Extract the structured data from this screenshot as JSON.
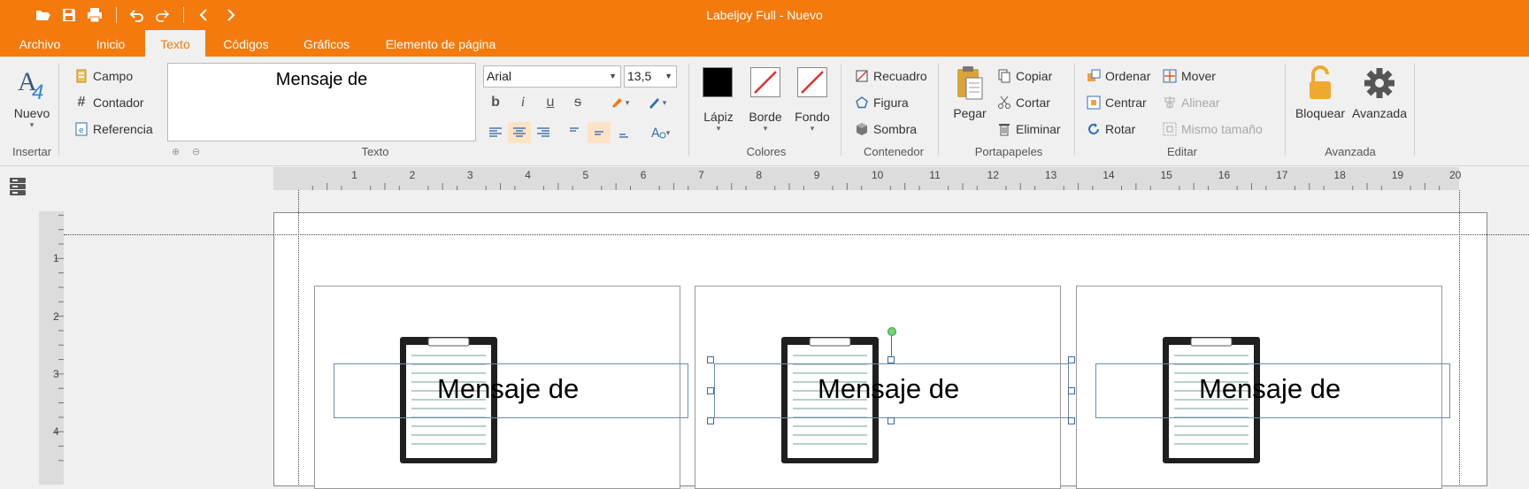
{
  "window": {
    "title": "Labeljoy Full - Nuevo"
  },
  "quick_access": [
    "open-icon",
    "save-icon",
    "print-icon",
    "undo-icon",
    "redo-icon",
    "back-icon",
    "forward-icon"
  ],
  "tabs": [
    {
      "label": "Archivo"
    },
    {
      "label": "Inicio"
    },
    {
      "label": "Texto",
      "active": true
    },
    {
      "label": "Códigos"
    },
    {
      "label": "Gráficos"
    },
    {
      "label": "Elemento de página"
    }
  ],
  "ribbon": {
    "insertar": {
      "group_label": "Insertar",
      "nuevo": "Nuevo",
      "campo": "Campo",
      "contador": "Contador",
      "referencia": "Referencia"
    },
    "texto": {
      "group_label": "Texto",
      "text_value": "Mensaje de",
      "font": "Arial",
      "size": "13,5"
    },
    "colores": {
      "group_label": "Colores",
      "lapiz": "Lápiz",
      "borde": "Borde",
      "fondo": "Fondo",
      "lapiz_color": "#000000"
    },
    "contenedor": {
      "group_label": "Contenedor",
      "recuadro": "Recuadro",
      "figura": "Figura",
      "sombra": "Sombra"
    },
    "portapapeles": {
      "group_label": "Portapapeles",
      "pegar": "Pegar",
      "copiar": "Copiar",
      "cortar": "Cortar",
      "eliminar": "Eliminar"
    },
    "editar": {
      "group_label": "Editar",
      "ordenar": "Ordenar",
      "centrar": "Centrar",
      "rotar": "Rotar",
      "mover": "Mover",
      "alinear": "Alinear",
      "mismo_tamano": "Mismo tamaño"
    },
    "avanzada": {
      "group_label": "Avanzada",
      "bloquear": "Bloquear",
      "avanzada": "Avanzada"
    }
  },
  "ruler": {
    "h_numbers": [
      "1",
      "2",
      "3",
      "4",
      "5",
      "6",
      "7",
      "8",
      "9",
      "10",
      "11",
      "12",
      "13",
      "14",
      "15",
      "16",
      "17",
      "18",
      "19",
      "20"
    ],
    "v_numbers": [
      "1",
      "2",
      "3",
      "4"
    ]
  },
  "labels": [
    {
      "text": "Mensaje de"
    },
    {
      "text": "Mensaje de",
      "selected": true
    },
    {
      "text": "Mensaje de"
    }
  ]
}
